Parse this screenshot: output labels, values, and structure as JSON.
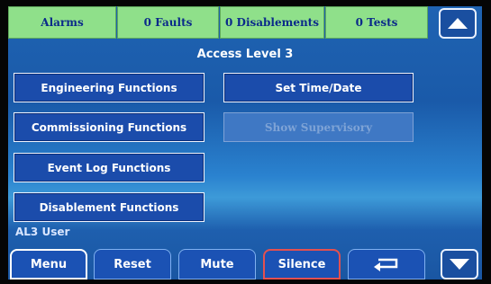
{
  "status_bar": {
    "alarms": "Alarms",
    "faults": "0 Faults",
    "disablements": "0 Disablements",
    "tests": "0 Tests"
  },
  "title": "Access Level 3",
  "functions": {
    "engineering": "Engineering Functions",
    "commissioning": "Commissioning Functions",
    "event_log": "Event Log Functions",
    "disablement": "Disablement Functions",
    "set_time_date": "Set Time/Date",
    "show_supervisory": "Show Supervisory"
  },
  "user_label": "AL3 User",
  "bottom_bar": {
    "menu": "Menu",
    "reset": "Reset",
    "mute": "Mute",
    "silence": "Silence"
  },
  "icons": {
    "scroll_up": "triangle-up-icon",
    "scroll_down": "triangle-down-icon",
    "back": "return-arrow-icon"
  },
  "colors": {
    "status_green": "#8fe08a",
    "button_blue": "#1b4cab",
    "panel_blue": "#1f63b2",
    "silence_border": "#e35050"
  }
}
